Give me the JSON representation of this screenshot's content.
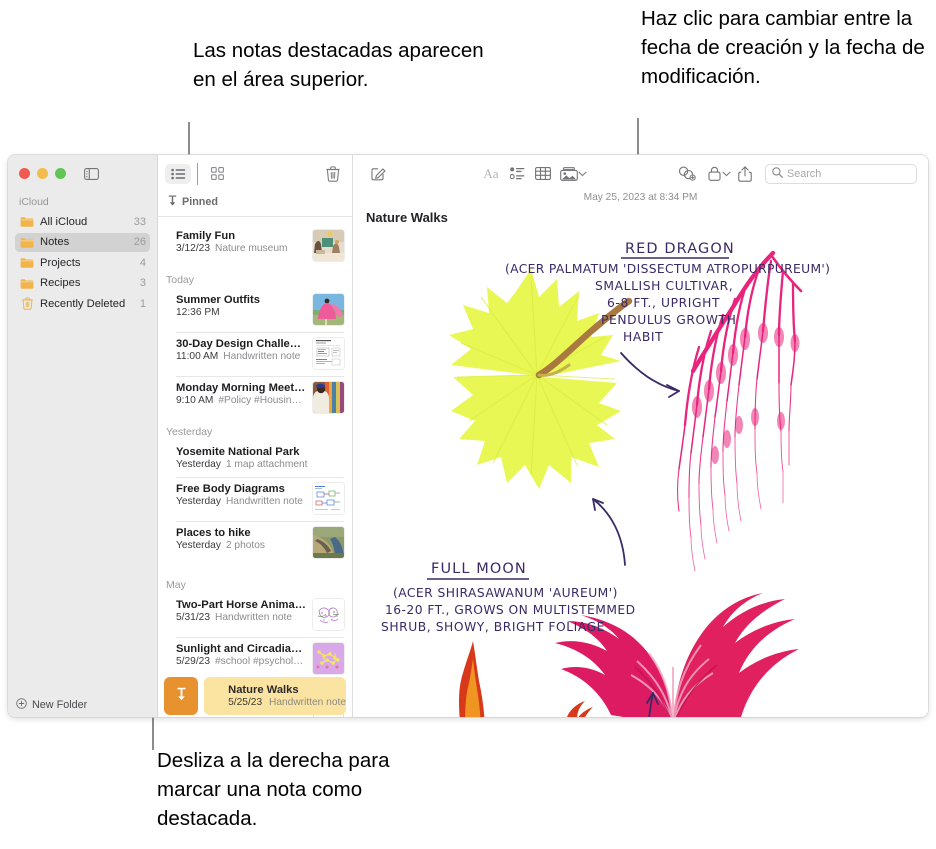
{
  "callouts": [
    {
      "id": "pinned-area",
      "text": "Las notas destacadas aparecen en el área superior."
    },
    {
      "id": "date-toggle",
      "text": "Haz clic para cambiar entre la fecha de creación y la fecha de modificación."
    },
    {
      "id": "swipe-pin",
      "text": "Desliza a la derecha para marcar una nota como destacada."
    }
  ],
  "window": {
    "traffic_lights": [
      "close",
      "minimize",
      "zoom"
    ],
    "sidebar_toggle_icon": "sidebar-toggle-icon"
  },
  "sidebar": {
    "section_label": "iCloud",
    "items": [
      {
        "label": "All iCloud",
        "count": "33",
        "icon": "folder-icon",
        "selected": false
      },
      {
        "label": "Notes",
        "count": "26",
        "icon": "folder-icon",
        "selected": true
      },
      {
        "label": "Projects",
        "count": "4",
        "icon": "folder-icon",
        "selected": false
      },
      {
        "label": "Recipes",
        "count": "3",
        "icon": "folder-icon",
        "selected": false
      },
      {
        "label": "Recently Deleted",
        "count": "1",
        "icon": "trash-icon",
        "selected": false
      }
    ],
    "new_folder_label": "New Folder",
    "new_folder_icon": "plus-circle-icon",
    "accent_color": "#e8912f",
    "background": "#ebebeb",
    "selected_background": "#d2d2d2"
  },
  "notes_column": {
    "toolbar": {
      "list_view_icon": "list-view-icon",
      "gallery_view_icon": "gallery-view-icon",
      "delete_icon": "trash-icon",
      "active_view": "list"
    },
    "pinned_header": {
      "label": "Pinned",
      "icon": "pin-icon"
    },
    "groups": [
      {
        "label": "",
        "notes": [
          {
            "title": "Family Fun",
            "date": "3/12/23",
            "detail": "Nature museum",
            "thumb": "photo-family"
          }
        ]
      },
      {
        "label": "Today",
        "notes": [
          {
            "title": "Summer Outfits",
            "date": "12:36 PM",
            "detail": "",
            "thumb": "photo-dress"
          },
          {
            "title": "30-Day Design Challen…",
            "date": "11:00 AM",
            "detail": "Handwritten note",
            "thumb": "doc-sketch"
          },
          {
            "title": "Monday Morning Meeting",
            "date": "9:10 AM",
            "detail": "#Policy #Housing…",
            "thumb": "photo-meeting"
          }
        ]
      },
      {
        "label": "Yesterday",
        "notes": [
          {
            "title": "Yosemite National Park",
            "date": "Yesterday",
            "detail": "1 map attachment",
            "thumb": ""
          },
          {
            "title": "Free Body Diagrams",
            "date": "Yesterday",
            "detail": "Handwritten note",
            "thumb": "doc-diagram"
          },
          {
            "title": "Places to hike",
            "date": "Yesterday",
            "detail": "2 photos",
            "thumb": "photo-road"
          }
        ]
      },
      {
        "label": "May",
        "notes": [
          {
            "title": "Two-Part Horse Anima…",
            "date": "5/31/23",
            "detail": "Handwritten note",
            "thumb": "doc-horse"
          },
          {
            "title": "Sunlight and Circadian…",
            "date": "5/29/23",
            "detail": "#school #psycholo…",
            "thumb": "photo-molecule"
          }
        ]
      }
    ],
    "swipe_row": {
      "pin_button_icon": "pin-icon",
      "pin_button_color": "#e8912f",
      "card_color": "#fbe3a2",
      "title": "Nature Walks",
      "date": "5/25/23",
      "detail": "Handwritten note"
    }
  },
  "detail": {
    "toolbar": {
      "compose_icon": "compose-icon",
      "format_icon": "Aa",
      "checklist_icon": "checklist-icon",
      "table_icon": "table-icon",
      "media_icon": "media-icon",
      "media_chevron": "chevron-down-icon",
      "collaborate_icon": "collaborate-icon",
      "lock_icon": "lock-icon",
      "lock_chevron": "chevron-down-icon",
      "share_icon": "share-icon"
    },
    "search": {
      "placeholder": "Search",
      "icon": "search-icon"
    },
    "date": "May 25, 2023 at 8:34 PM",
    "title": "Nature Walks",
    "handwriting": {
      "heading_1": "RED DRAGON",
      "lines_1": [
        "(ACER PALMATUM 'DISSECTUM ATROPURPUREUM')",
        "SMALLISH CULTIVAR,",
        "6-8 FT., UPRIGHT",
        "PENDULUS GROWTH",
        "HABIT"
      ],
      "heading_2": "FULL MOON",
      "lines_2": [
        "(ACER SHIRASAWANUM 'AUREUM')",
        "16-20 FT., GROWS ON MULTISTEMMED",
        "SHRUB, SHOWY, BRIGHT FOLIAGE"
      ],
      "ink_color": "#3a2a66"
    },
    "illustrations": [
      {
        "name": "yellow-maple-leaf",
        "color": "#e6f54a"
      },
      {
        "name": "pink-weeping-branch",
        "color": "#ea2a7b"
      },
      {
        "name": "pink-maple-leaf",
        "color": "#e0195f"
      },
      {
        "name": "orange-leaf",
        "color": "#e2431a"
      }
    ]
  }
}
